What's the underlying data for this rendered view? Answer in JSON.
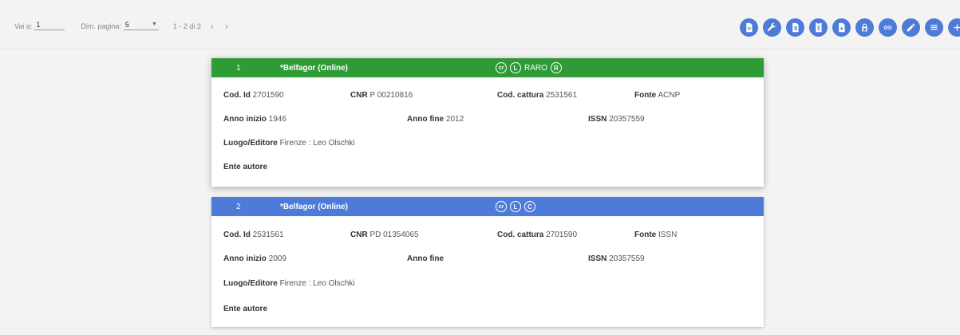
{
  "pager": {
    "goto_label": "Vai a:",
    "goto_value": "1",
    "size_label": "Dim. pagina:",
    "size_value": "5",
    "range": "1 - 2 di 2",
    "prev": "‹",
    "next": "›"
  },
  "actions": [
    "document-icon",
    "wrench-icon",
    "doc-b-icon",
    "doc-e-icon",
    "doc-c-icon",
    "lock-icon",
    "link-icon",
    "pencil-icon",
    "list-icon",
    "plus-icon"
  ],
  "records": [
    {
      "num": "1",
      "title": "*Belfagor (Online)",
      "badges": [
        "cr",
        "L",
        "RARO",
        "R"
      ],
      "cod_id_label": "Cod. Id",
      "cod_id": "2701590",
      "cnr_label": "CNR",
      "cnr": "P 00210816",
      "cattura_label": "Cod. cattura",
      "cattura": "2531561",
      "fonte_label": "Fonte",
      "fonte": "ACNP",
      "anno_inizio_label": "Anno inizio",
      "anno_inizio": "1946",
      "anno_fine_label": "Anno fine",
      "anno_fine": "2012",
      "issn_label": "ISSN",
      "issn": "20357559",
      "luogo_label": "Luogo/Editore",
      "luogo": "Firenze : Leo Olschki",
      "ente_label": "Ente autore",
      "ente": ""
    },
    {
      "num": "2",
      "title": "*Belfagor (Online)",
      "badges": [
        "cr",
        "L",
        "C"
      ],
      "cod_id_label": "Cod. Id",
      "cod_id": "2531561",
      "cnr_label": "CNR",
      "cnr": "PD 01354065",
      "cattura_label": "Cod. cattura",
      "cattura": "2701590",
      "fonte_label": "Fonte",
      "fonte": "ISSN",
      "anno_inizio_label": "Anno inizio",
      "anno_inizio": "2009",
      "anno_fine_label": "Anno fine",
      "anno_fine": "",
      "issn_label": "ISSN",
      "issn": "20357559",
      "luogo_label": "Luogo/Editore",
      "luogo": "Firenze : Leo Olschki",
      "ente_label": "Ente autore",
      "ente": ""
    }
  ],
  "colors": {
    "accent": "#4f7bd8",
    "selected": "#2e9b36"
  }
}
